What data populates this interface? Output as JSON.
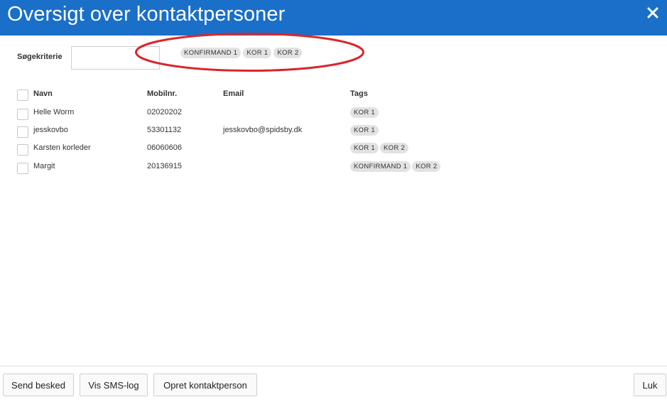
{
  "header": {
    "title": "Oversigt over kontaktpersoner",
    "close_icon": "close-icon"
  },
  "search": {
    "label": "Søgekriterie",
    "value": "",
    "placeholder": ""
  },
  "filter_tags": [
    "KONFIRMAND 1",
    "KOR 1",
    "KOR 2"
  ],
  "table": {
    "columns": {
      "name": "Navn",
      "phone": "Mobilnr.",
      "email": "Email",
      "tags": "Tags"
    },
    "rows": [
      {
        "name": "Helle Worm",
        "phone": "02020202",
        "email": "",
        "tags": [
          "KOR 1"
        ]
      },
      {
        "name": "jesskovbo",
        "phone": "53301132",
        "email": "jesskovbo@spidsby.dk",
        "tags": [
          "KOR 1"
        ]
      },
      {
        "name": "Karsten korleder",
        "phone": "06060606",
        "email": "",
        "tags": [
          "KOR 1",
          "KOR 2"
        ]
      },
      {
        "name": "Margit",
        "phone": "20136915",
        "email": "",
        "tags": [
          "KONFIRMAND 1",
          "KOR 2"
        ]
      }
    ]
  },
  "footer": {
    "send_label": "Send besked",
    "sms_log_label": "Vis SMS-log",
    "create_label": "Opret kontaktperson",
    "close_label": "Luk"
  },
  "colors": {
    "header_bg": "#1a6fc9",
    "annotation": "#d9262b",
    "tag_bg": "#e2e2e2"
  }
}
